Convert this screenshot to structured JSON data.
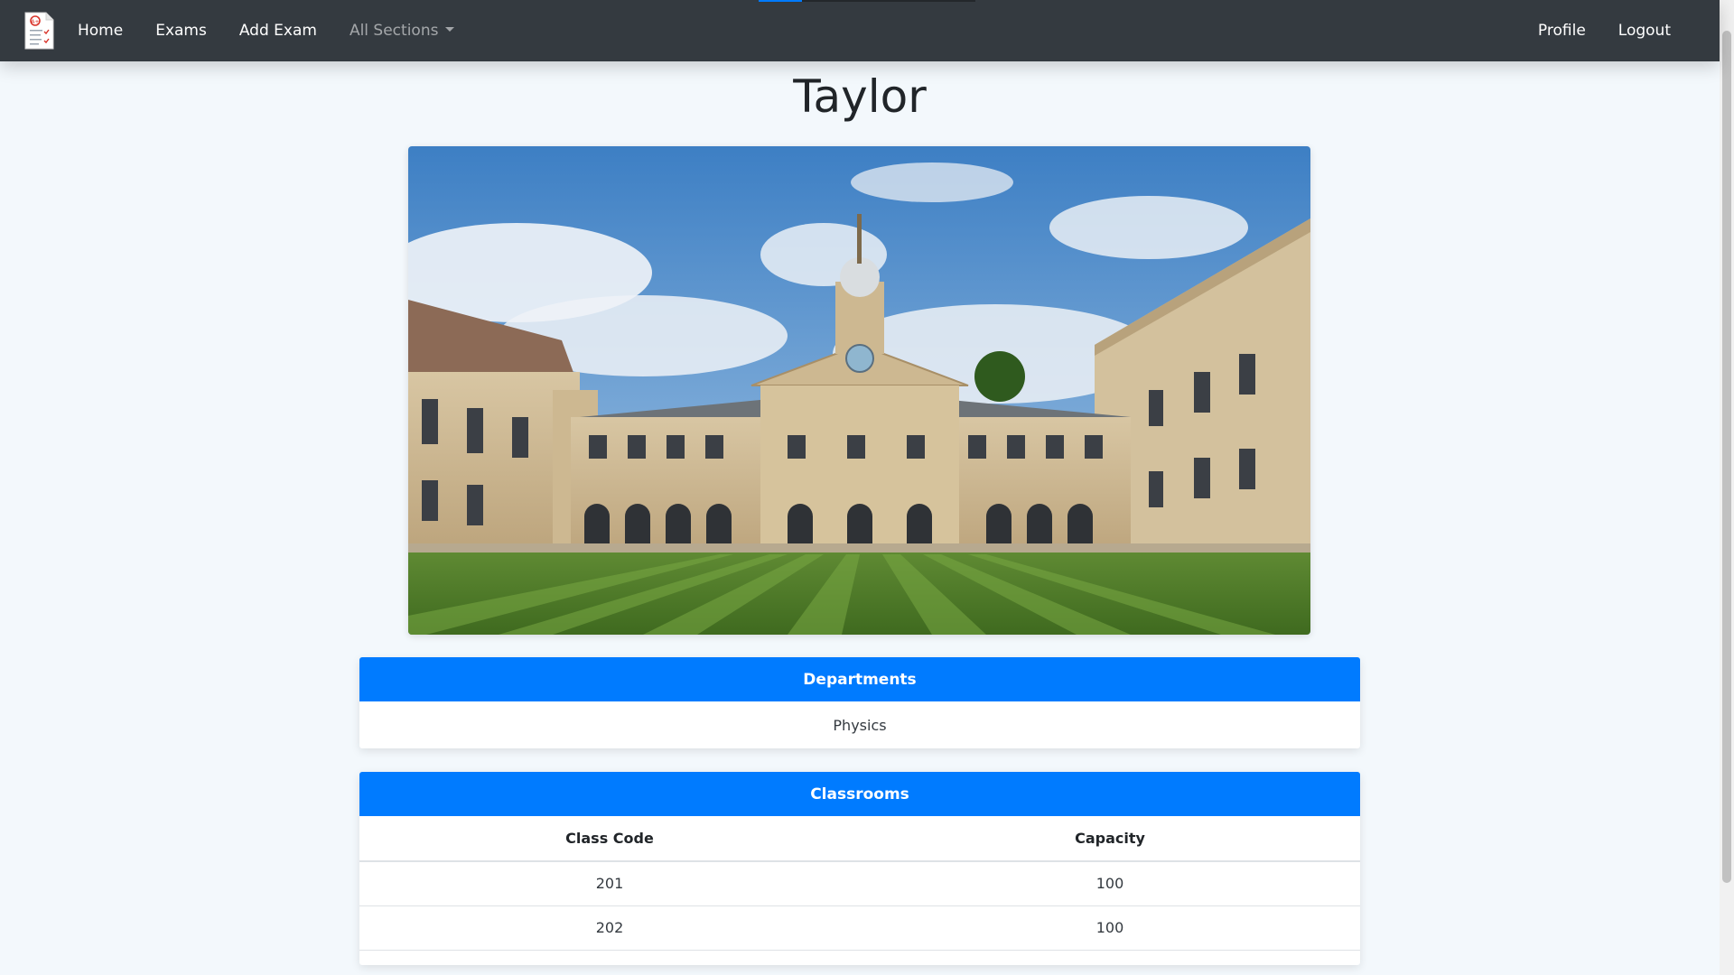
{
  "nav": {
    "home": "Home",
    "exams": "Exams",
    "add_exam": "Add Exam",
    "sections": "All Sections",
    "profile": "Profile",
    "logout": "Logout",
    "loading_progress": 0.2,
    "accent": "#007bff",
    "bg": "#343a40"
  },
  "page": {
    "title": "Taylor"
  },
  "departments": {
    "header": "Departments",
    "items": [
      "Physics"
    ]
  },
  "classrooms": {
    "header": "Classrooms",
    "columns": [
      "Class Code",
      "Capacity"
    ],
    "rows": [
      [
        "201",
        "100"
      ],
      [
        "202",
        "100"
      ]
    ]
  },
  "icons": {
    "brand": "exam-document-icon",
    "dropdown": "caret-down-icon"
  }
}
